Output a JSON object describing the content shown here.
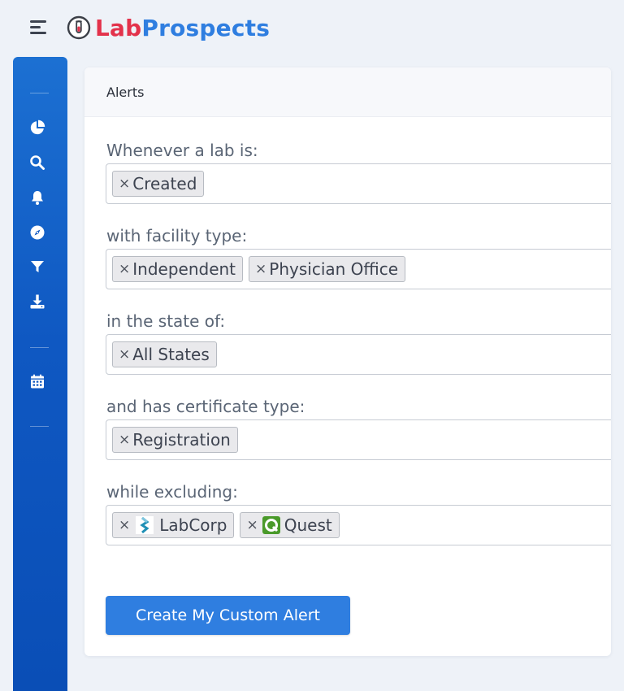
{
  "brand": {
    "lab": "Lab",
    "prospects": "Prospects"
  },
  "sidebar": {
    "icons": [
      "chart-pie-icon",
      "search-icon",
      "bell-icon",
      "compass-icon",
      "filter-icon",
      "download-icon",
      "calendar-icon"
    ]
  },
  "card": {
    "title": "Alerts",
    "fields": [
      {
        "label": "Whenever a lab is:",
        "tags": [
          "Created"
        ]
      },
      {
        "label": "with facility type:",
        "tags": [
          "Independent",
          "Physician Office"
        ]
      },
      {
        "label": "in the state of:",
        "tags": [
          "All States"
        ]
      },
      {
        "label": "and has certificate type:",
        "tags": [
          "Registration"
        ]
      },
      {
        "label": "while excluding:",
        "tags": [
          "LabCorp",
          "Quest"
        ]
      }
    ],
    "tag_remove_symbol": "×",
    "submit_label": "Create My Custom Alert"
  },
  "colors": {
    "sidebar": "#0f58c2",
    "primary": "#2f7ee0",
    "brand_red": "#e3324b",
    "background": "#eef2f8"
  }
}
